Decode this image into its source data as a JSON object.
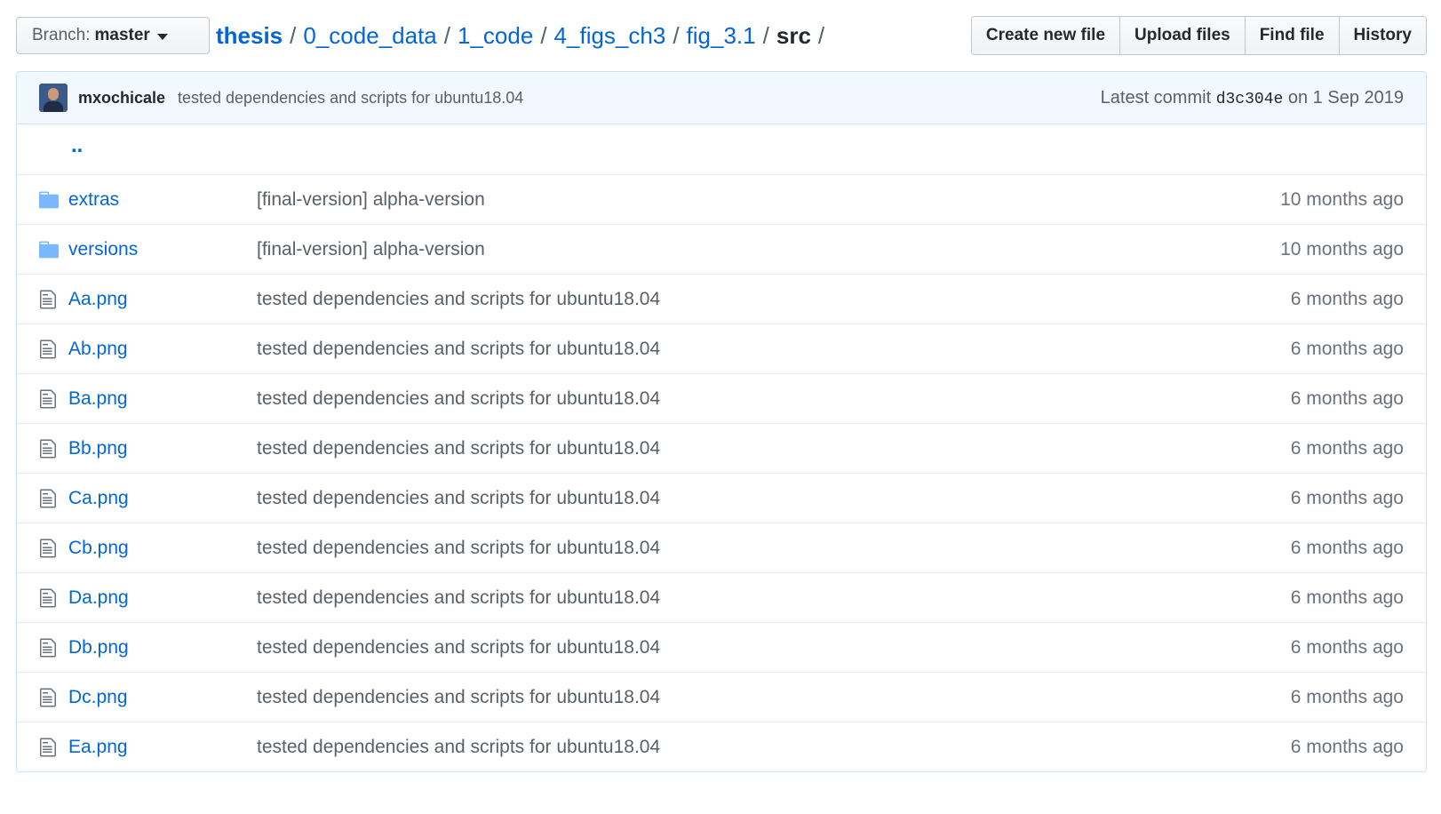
{
  "branch": {
    "label": "Branch:",
    "value": "master"
  },
  "breadcrumb": {
    "root": "thesis",
    "parts": [
      "0_code_data",
      "1_code",
      "4_figs_ch3",
      "fig_3.1"
    ],
    "final": "src",
    "separator": "/"
  },
  "actions": {
    "create": "Create new file",
    "upload": "Upload files",
    "find": "Find file",
    "history": "History"
  },
  "commit": {
    "author": "mxochicale",
    "message": "tested dependencies and scripts for ubuntu18.04",
    "latest_label": "Latest commit",
    "sha": "d3c304e",
    "date": "on 1 Sep 2019"
  },
  "up_dir": "..",
  "files": [
    {
      "name": "extras",
      "type": "folder",
      "message": "[final-version] alpha-version",
      "age": "10 months ago"
    },
    {
      "name": "versions",
      "type": "folder",
      "message": "[final-version] alpha-version",
      "age": "10 months ago"
    },
    {
      "name": "Aa.png",
      "type": "file",
      "message": "tested dependencies and scripts for ubuntu18.04",
      "age": "6 months ago"
    },
    {
      "name": "Ab.png",
      "type": "file",
      "message": "tested dependencies and scripts for ubuntu18.04",
      "age": "6 months ago"
    },
    {
      "name": "Ba.png",
      "type": "file",
      "message": "tested dependencies and scripts for ubuntu18.04",
      "age": "6 months ago"
    },
    {
      "name": "Bb.png",
      "type": "file",
      "message": "tested dependencies and scripts for ubuntu18.04",
      "age": "6 months ago"
    },
    {
      "name": "Ca.png",
      "type": "file",
      "message": "tested dependencies and scripts for ubuntu18.04",
      "age": "6 months ago"
    },
    {
      "name": "Cb.png",
      "type": "file",
      "message": "tested dependencies and scripts for ubuntu18.04",
      "age": "6 months ago"
    },
    {
      "name": "Da.png",
      "type": "file",
      "message": "tested dependencies and scripts for ubuntu18.04",
      "age": "6 months ago"
    },
    {
      "name": "Db.png",
      "type": "file",
      "message": "tested dependencies and scripts for ubuntu18.04",
      "age": "6 months ago"
    },
    {
      "name": "Dc.png",
      "type": "file",
      "message": "tested dependencies and scripts for ubuntu18.04",
      "age": "6 months ago"
    },
    {
      "name": "Ea.png",
      "type": "file",
      "message": "tested dependencies and scripts for ubuntu18.04",
      "age": "6 months ago"
    }
  ],
  "colors": {
    "link": "#0366d6",
    "muted": "#586069",
    "commit_bar_bg": "#f1f8ff",
    "folder_icon": "#79b8ff",
    "file_icon": "#6a737d"
  }
}
